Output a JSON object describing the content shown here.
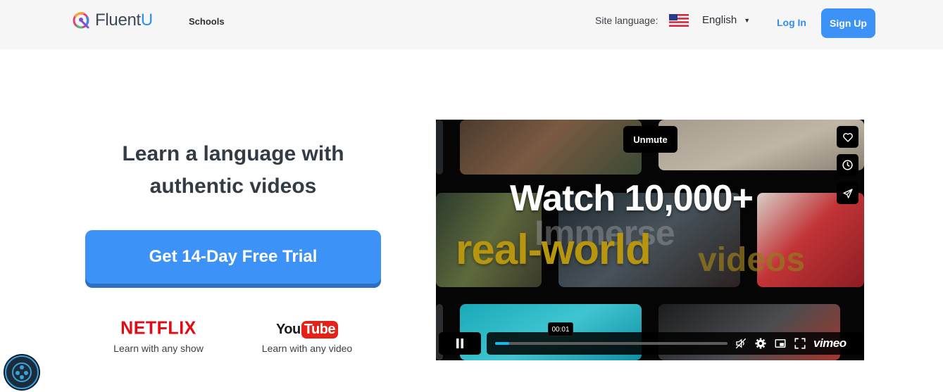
{
  "header": {
    "brand_prefix": "Fluent",
    "brand_suffix": "U",
    "nav_schools": "Schools",
    "site_language_label": "Site language:",
    "language_value": "English",
    "login": "Log In",
    "signup": "Sign Up"
  },
  "hero": {
    "headline_line1": "Learn a language with",
    "headline_line2": "authentic videos",
    "cta": "Get 14-Day Free Trial"
  },
  "partners": [
    {
      "brand": "NETFLIX",
      "caption": "Learn with any show"
    },
    {
      "brand_you": "You",
      "brand_tube": "Tube",
      "caption": "Learn with any video"
    }
  ],
  "video": {
    "unmute": "Unmute",
    "headline": "Watch 10,000+",
    "overlay_immerse": "Immerse",
    "overlay_realworld": "real-world",
    "overlay_videos": "videos",
    "time": "00:01",
    "progress": 0.06,
    "watermark": "vimeo"
  },
  "colors": {
    "accent": "#3d92f7",
    "netflix": "#e50914",
    "youtube": "#e62117",
    "vimeo_progress": "#1ab7ea"
  },
  "icons": [
    "fluentu-logo-icon",
    "us-flag-icon",
    "chevron-down-icon",
    "heart-icon",
    "clock-icon",
    "send-icon",
    "pause-icon",
    "volume-muted-icon",
    "settings-icon",
    "pip-icon",
    "fullscreen-icon",
    "accessibility-icon"
  ]
}
